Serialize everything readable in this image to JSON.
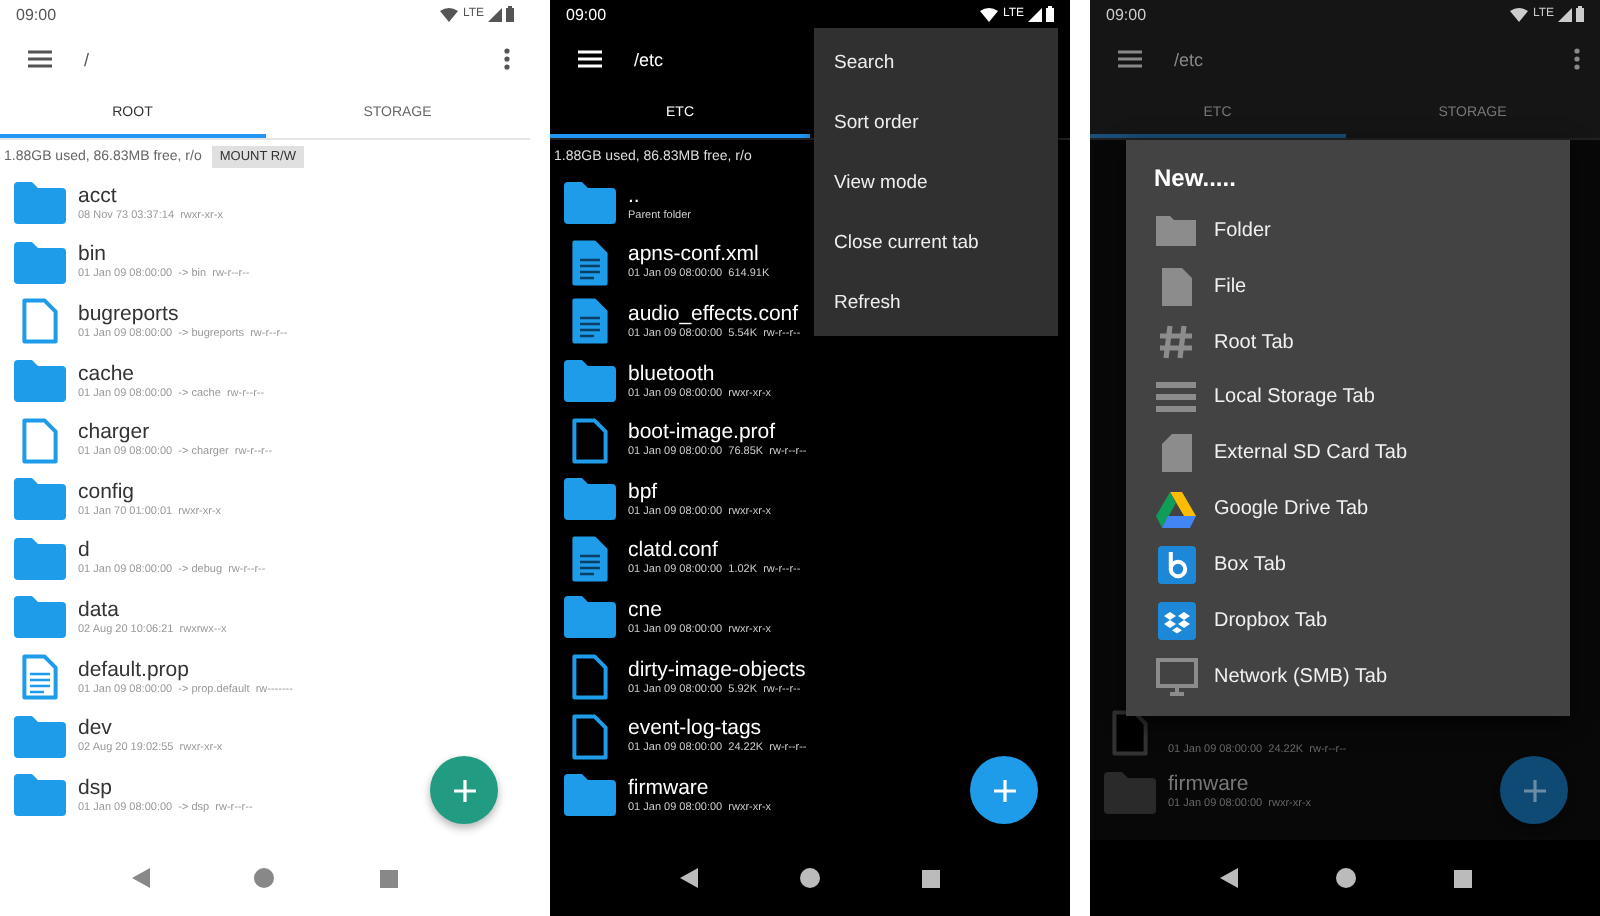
{
  "screens": [
    {
      "kind": "light",
      "dimmed": false,
      "status_bar": {
        "time": "09:00",
        "network": "LTE"
      },
      "toolbar": {
        "path": "/",
        "more": true
      },
      "tabs": [
        {
          "label": "ROOT",
          "selected": true
        },
        {
          "label": "STORAGE",
          "selected": false
        }
      ],
      "storage_info": "1.88GB used, 86.83MB free, r/o",
      "mount_button": "MOUNT R/W",
      "files": [
        {
          "kind": "folder",
          "name": "acct",
          "meta": "08 Nov 73 03:37:14  rwxr-xr-x"
        },
        {
          "kind": "folder",
          "name": "bin",
          "meta": "01 Jan 09 08:00:00  -> bin  rw-r--r--"
        },
        {
          "kind": "file",
          "name": "bugreports",
          "meta": "01 Jan 09 08:00:00  -> bugreports  rw-r--r--"
        },
        {
          "kind": "folder",
          "name": "cache",
          "meta": "01 Jan 09 08:00:00  -> cache  rw-r--r--"
        },
        {
          "kind": "file",
          "name": "charger",
          "meta": "01 Jan 09 08:00:00  -> charger  rw-r--r--"
        },
        {
          "kind": "folder",
          "name": "config",
          "meta": "01 Jan 70 01:00:01  rwxr-xr-x"
        },
        {
          "kind": "folder",
          "name": "d",
          "meta": "01 Jan 09 08:00:00  -> debug  rw-r--r--"
        },
        {
          "kind": "folder",
          "name": "data",
          "meta": "02 Aug 20 10:06:21  rwxrwx--x"
        },
        {
          "kind": "doc",
          "name": "default.prop",
          "meta": "01 Jan 09 08:00:00  -> prop.default  rw-------"
        },
        {
          "kind": "folder",
          "name": "dev",
          "meta": "02 Aug 20 19:02:55  rwxr-xr-x"
        },
        {
          "kind": "folder",
          "name": "dsp",
          "meta": "01 Jan 09 08:00:00  -> dsp  rw-r--r--"
        }
      ]
    },
    {
      "kind": "dark",
      "dimmed": false,
      "status_bar": {
        "time": "09:00",
        "network": "LTE"
      },
      "toolbar": {
        "path": "/etc"
      },
      "tabs": [
        {
          "label": "ETC",
          "selected": true
        }
      ],
      "storage_info": "1.88GB used, 86.83MB free, r/o",
      "files": [
        {
          "kind": "folder",
          "name": "..",
          "meta": "Parent folder"
        },
        {
          "kind": "doc",
          "name": "apns-conf.xml",
          "meta": "01 Jan 09 08:00:00  614.91K"
        },
        {
          "kind": "doc",
          "name": "audio_effects.conf",
          "meta": "01 Jan 09 08:00:00  5.54K  rw-r--r--"
        },
        {
          "kind": "folder",
          "name": "bluetooth",
          "meta": "01 Jan 09 08:00:00  rwxr-xr-x"
        },
        {
          "kind": "file",
          "name": "boot-image.prof",
          "meta": "01 Jan 09 08:00:00  76.85K  rw-r--r--"
        },
        {
          "kind": "folder",
          "name": "bpf",
          "meta": "01 Jan 09 08:00:00  rwxr-xr-x"
        },
        {
          "kind": "doc",
          "name": "clatd.conf",
          "meta": "01 Jan 09 08:00:00  1.02K  rw-r--r--"
        },
        {
          "kind": "folder",
          "name": "cne",
          "meta": "01 Jan 09 08:00:00  rwxr-xr-x"
        },
        {
          "kind": "file",
          "name": "dirty-image-objects",
          "meta": "01 Jan 09 08:00:00  5.92K  rw-r--r--"
        },
        {
          "kind": "file",
          "name": "event-log-tags",
          "meta": "01 Jan 09 08:00:00  24.22K  rw-r--r--"
        },
        {
          "kind": "folder",
          "name": "firmware",
          "meta": "01 Jan 09 08:00:00  rwxr-xr-x"
        }
      ],
      "menu": {
        "items": [
          "Search",
          "Sort order",
          "View mode",
          "Close current tab",
          "Refresh"
        ]
      }
    },
    {
      "kind": "dark",
      "dimmed": true,
      "status_bar": {
        "time": "09:00",
        "network": "LTE"
      },
      "toolbar": {
        "path": "/etc",
        "more": true
      },
      "tabs": [
        {
          "label": "ETC",
          "selected": true
        },
        {
          "label": "STORAGE",
          "selected": false
        }
      ],
      "files": [
        {
          "kind": "file",
          "meta": "01 Jan 09 08:00:00  24.22K  rw-r--r--"
        },
        {
          "kind": "folder",
          "name": "firmware",
          "meta": "01 Jan 09 08:00:00  rwxr-xr-x"
        }
      ],
      "dialog": {
        "title": "New.....",
        "items": [
          {
            "kind": "folder",
            "label": "Folder"
          },
          {
            "kind": "file",
            "label": "File"
          },
          {
            "kind": "root",
            "label": "Root Tab"
          },
          {
            "kind": "storage",
            "label": "Local Storage Tab"
          },
          {
            "kind": "sdcard",
            "label": "External SD Card Tab"
          },
          {
            "kind": "drive",
            "label": "Google Drive Tab"
          },
          {
            "kind": "box",
            "label": "Box Tab"
          },
          {
            "kind": "dropbox",
            "label": "Dropbox Tab"
          },
          {
            "kind": "network",
            "label": "Network (SMB) Tab"
          }
        ]
      }
    }
  ]
}
